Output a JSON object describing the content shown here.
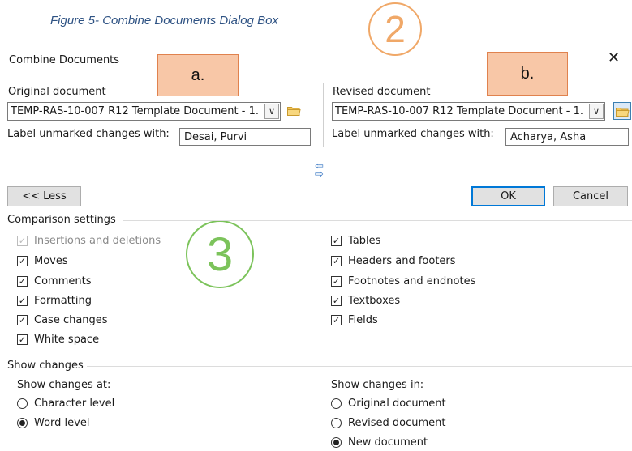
{
  "caption": "Figure 5- Combine Documents Dialog Box",
  "dialog": {
    "title": "Combine Documents",
    "help_symbol": "?",
    "close_symbol": "✕"
  },
  "annotations": {
    "box_a": "a.",
    "box_b": "b.",
    "circle_2": "2",
    "circle_3": "3",
    "colors": {
      "box_fill": "#f8c7a7",
      "box_border": "#e0824e",
      "circle_2": "#f0a868",
      "circle_3": "#7cc35b"
    }
  },
  "original": {
    "label": "Original document",
    "value": "TEMP-RAS-10-007 R12 Template Document - 1.",
    "unmarked_label": "Label unmarked changes with:",
    "unmarked_value": "Desai, Purvi"
  },
  "revised": {
    "label": "Revised document",
    "value": "TEMP-RAS-10-007 R12 Template Document - 1.",
    "unmarked_label": "Label unmarked changes with:",
    "unmarked_value": "Acharya, Asha"
  },
  "buttons": {
    "less": "<< Less",
    "ok": "OK",
    "cancel": "Cancel"
  },
  "comparison": {
    "heading": "Comparison settings",
    "left": [
      {
        "label": "Insertions and deletions",
        "checked": true,
        "disabled": true
      },
      {
        "label": "Moves",
        "checked": true
      },
      {
        "label": "Comments",
        "checked": true
      },
      {
        "label": "Formatting",
        "checked": true
      },
      {
        "label": "Case changes",
        "checked": true
      },
      {
        "label": "White space",
        "checked": true
      }
    ],
    "right": [
      {
        "label": "Tables",
        "checked": true
      },
      {
        "label": "Headers and footers",
        "checked": true
      },
      {
        "label": "Footnotes and endnotes",
        "checked": true
      },
      {
        "label": "Textboxes",
        "checked": true
      },
      {
        "label": "Fields",
        "checked": true
      }
    ]
  },
  "show_changes": {
    "heading": "Show changes",
    "at_label": "Show changes at:",
    "at_options": [
      {
        "label": "Character level",
        "selected": false
      },
      {
        "label": "Word level",
        "selected": true
      }
    ],
    "in_label": "Show changes in:",
    "in_options": [
      {
        "label": "Original document",
        "selected": false
      },
      {
        "label": "Revised document",
        "selected": false
      },
      {
        "label": "New document",
        "selected": true
      }
    ]
  },
  "icons": {
    "folder": "folder-icon",
    "swap": "swap-arrows-icon",
    "dropdown": "chevron-down-icon",
    "check": "checkmark-icon"
  }
}
